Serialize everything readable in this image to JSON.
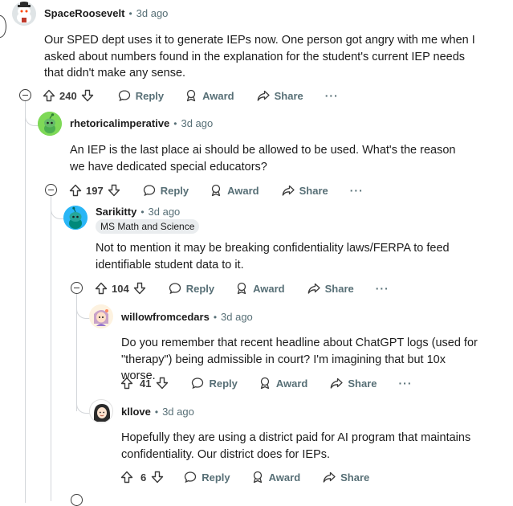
{
  "comments": [
    {
      "username": "SpaceRoosevelt",
      "dot": "•",
      "time": "3d ago",
      "body": "Our SPED dept uses it to generate IEPs now. One person got angry with me when I asked about numbers found in the explanation for the student's current IEP needs that didn't make any sense.",
      "votes": "240",
      "reply": "Reply",
      "award": "Award",
      "share": "Share",
      "more": "···"
    },
    {
      "username": "rhetoricalimperative",
      "dot": "•",
      "time": "3d ago",
      "body": "An IEP is the last place ai should be allowed to be used. What's the reason we have dedicated special educators?",
      "votes": "197",
      "reply": "Reply",
      "award": "Award",
      "share": "Share",
      "more": "···"
    },
    {
      "username": "Sarikitty",
      "dot": "•",
      "time": "3d ago",
      "flair": "MS Math and Science",
      "body": "Not to mention it may be breaking confidentiality laws/FERPA to feed identifiable student data to it.",
      "votes": "104",
      "reply": "Reply",
      "award": "Award",
      "share": "Share",
      "more": "···"
    },
    {
      "username": "willowfromcedars",
      "dot": "•",
      "time": "3d ago",
      "body": "Do you remember that recent headline about ChatGPT logs (used for \"therapy\") being admissible in court? I'm imagining that but 10x worse.",
      "votes": "41",
      "reply": "Reply",
      "award": "Award",
      "share": "Share",
      "more": "···"
    },
    {
      "username": "kllove",
      "dot": "•",
      "time": "3d ago",
      "body": "Hopefully they are using a district paid for AI program that maintains confidentiality. Our district does for IEPs.",
      "votes": "6",
      "reply": "Reply",
      "award": "Award",
      "share": "Share",
      "more": "···"
    }
  ],
  "colors": {
    "text": "#1c1c1c",
    "meta": "#576f76",
    "thread_line": "#d3d6da",
    "flair_bg": "#eaedef"
  }
}
